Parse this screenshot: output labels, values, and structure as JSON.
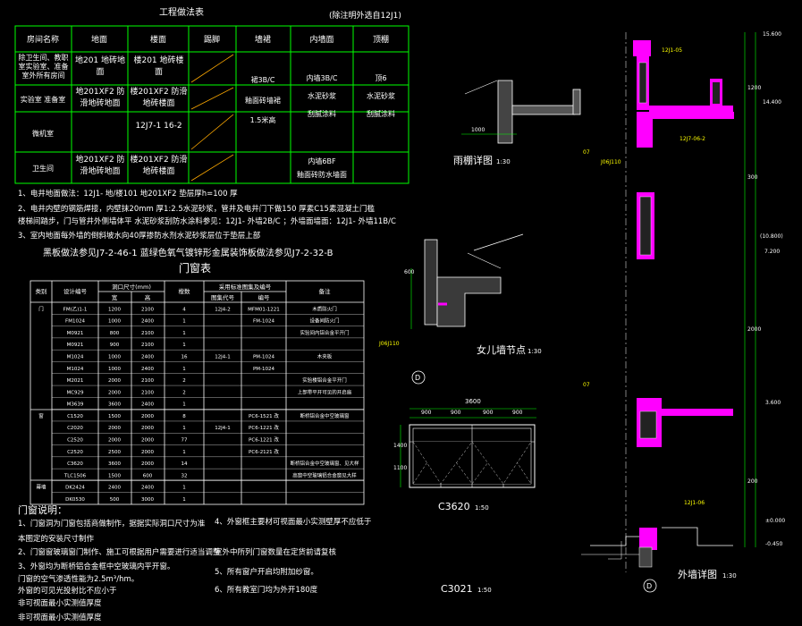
{
  "finish_table": {
    "title": "工程做法表",
    "note": "(除注明外选自12J1)",
    "headers": [
      "房间名称",
      "地面",
      "楼面",
      "踢脚",
      "墙裙",
      "内墙面",
      "顶棚"
    ],
    "rows": [
      {
        "room": "除卫生间、教职室实验室、准备室外所有房间",
        "floor": "地201 地砖地面",
        "upper_floor": "楼201 地砖楼面"
      },
      {
        "room": "实验室 准备室",
        "floor": "地201XF2 防滑地砖地面",
        "upper_floor": "楼201XF2 防滑地砖楼面"
      },
      {
        "room": "微机室",
        "floor": "",
        "upper_floor": "12J7-1 16-2"
      },
      {
        "room": "卫生间",
        "floor": "地201XF2 防滑地砖地面",
        "upper_floor": "楼201XF2 防滑地砖楼面"
      }
    ],
    "wainscot": [
      "裙3B/C",
      "釉面砖墙裙",
      "1.5米高"
    ],
    "inner_wall": [
      "内墙3B/C",
      "水泥砂浆",
      "刮腻涂料"
    ],
    "inner_wall_wc": [
      "内墙6BF",
      "釉面砖防水墙面"
    ],
    "ceiling": [
      "顶6",
      "水泥砂浆",
      "刮腻涂料"
    ]
  },
  "notes": [
    "1、电井地面做法：12J1- 地/楼101 地201XF2 垫层厚h=100 厚",
    "2、电井内壁的钢筋焊接，内壁抹20mm 厚1:2.5水泥砂浆，管井及电井门下做150 厚素C15素混凝土门槛",
    "     楼梯间踏步，门与管井外侧墙体平 水泥砂浆刮防水涂料参见：12J1- 外墙2B/C ；外墙面墙面：12J1- 外墙11B/C",
    "3、室内地面每外墙的倒斜坡水向40厚掺防水剂水泥砂浆层位于垫层上部"
  ],
  "blackboard_note": "黑板做法参见J7-2-46-1  蓝绿色氧气镀锌形金属装饰板做法参见J7-2-32-B",
  "door_table": {
    "title": "门窗表",
    "headers": [
      "类别",
      "设计编号",
      "洞口尺寸(mm)",
      "",
      "樘数",
      "采用标准图集及编号",
      "",
      "备注"
    ],
    "subheaders": [
      "宽",
      "高",
      "图集代号",
      "编号"
    ],
    "rows": [
      [
        "门",
        "FM(乙)1-1",
        "1200",
        "2100",
        "4",
        "12J4-2",
        "MFM01-1221",
        "木质防火门"
      ],
      [
        "",
        "FM1024",
        "1000",
        "2400",
        "1",
        "",
        "FM-1024",
        "设备间防火门"
      ],
      [
        "",
        "M0921",
        "800",
        "2100",
        "1",
        "",
        "",
        "实验间内铝合金平开门"
      ],
      [
        "",
        "M0921",
        "900",
        "2100",
        "1",
        "",
        "",
        ""
      ],
      [
        "",
        "M1024",
        "1000",
        "2400",
        "16",
        "12J4-1",
        "PM-1024",
        "木夹板"
      ],
      [
        "",
        "M1024",
        "1000",
        "2400",
        "1",
        "",
        "PM-1024",
        ""
      ],
      [
        "",
        "M2021",
        "2000",
        "2100",
        "2",
        "",
        "",
        "实验楼铝合金平开门"
      ],
      [
        "",
        "MC929",
        "2000",
        "2100",
        "2",
        "",
        "",
        "上部带平开可见的开启扇"
      ],
      [
        "",
        "M3639",
        "3600",
        "2400",
        "1",
        "",
        "",
        ""
      ],
      [
        "窗",
        "C1520",
        "1500",
        "2000",
        "8",
        "",
        "PC6-1521 改",
        "断桥铝合金中空玻璃窗"
      ],
      [
        "",
        "C2020",
        "2000",
        "2000",
        "1",
        "12J4-1",
        "PC6-1221 改",
        ""
      ],
      [
        "",
        "C2520",
        "2000",
        "2000",
        "77",
        "",
        "PC6-1221 改",
        ""
      ],
      [
        "",
        "C2520",
        "2500",
        "2000",
        "1",
        "",
        "PC6-2121 改",
        ""
      ],
      [
        "",
        "C3620",
        "3600",
        "2000",
        "14",
        "",
        "",
        "断桥铝合金中空玻璃窗、见大样"
      ],
      [
        "",
        "TLC1506",
        "1500",
        "600",
        "32",
        "",
        "",
        "高窗中空玻璃铝合金窗见大样"
      ],
      [
        "幕墙",
        "DK2424",
        "2400",
        "2400",
        "1",
        "",
        "",
        ""
      ],
      [
        "",
        "DK0530",
        "500",
        "3000",
        "1",
        "",
        "",
        ""
      ]
    ]
  },
  "door_notes": {
    "title": "门窗说明：",
    "items": [
      "1、门窗洞为门窗包括商做制作，据据实际洞口尺寸为准",
      "   本图定的安装尺寸制作",
      "2、门窗窗玻璃窗门制作、施工可根据用户需要进行适当调整",
      "3、外窗均为断桥铝合金框中空玻璃内平开窗。",
      "   门窗的空气渗透性能为2.5m³/hm。",
      "   外窗的可见光投射比不应小于",
      "   非可视面最小实测值厚度",
      "   非可视面最小实测值厚度"
    ],
    "items_right": [
      "4、外窗框主要材可视面最小实测壁厚不应低于",
      "   室外中所列门窗数量在定货前请复核",
      "5、所有窗户开启均附加纱窗。",
      "6、所有教室门均为外开180度"
    ]
  },
  "details": {
    "canopy_title": "雨棚详图",
    "canopy_scale": "1:30",
    "parapet_title": "女儿墙节点",
    "parapet_scale": "1:30",
    "window_a_title": "C3620",
    "window_a_scale": "1:50",
    "window_b_title": "C3021",
    "window_b_scale": "1:50",
    "wall_title": "外墙详图",
    "wall_scale": "1:30",
    "axis_label": "D",
    "dim_labels": [
      "1000",
      "600",
      "3600",
      "900",
      "900",
      "900",
      "900",
      "1400",
      "1100",
      "2000",
      "300",
      "200",
      "1200"
    ],
    "elevations": [
      "15.600",
      "14.400",
      "(10.800)",
      "7.200",
      "3.600",
      "±0.000",
      "-0.450"
    ],
    "tags": [
      "12J1-05",
      "07",
      "J06J110",
      "12J7-06-2",
      "07",
      "12J1-06",
      "女墙"
    ]
  },
  "colors": {
    "background": "#000000",
    "lines": "#ffffff",
    "table_lines": "#00ff00",
    "tags": "#ffff00",
    "walls": "#ff00ff",
    "dimensions": "#00ff00"
  }
}
